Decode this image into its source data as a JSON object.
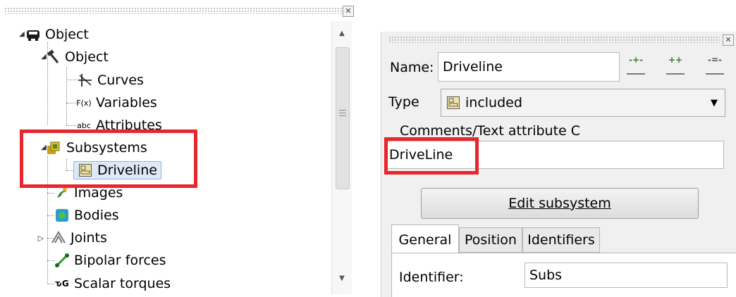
{
  "tree": {
    "root_label": "Object",
    "object_label": "Object",
    "curves_label": "Curves",
    "variables_label": "Variables",
    "attributes_label": "Attributes",
    "subsystems_label": "Subsystems",
    "driveline_label": "Driveline",
    "images_label": "Images",
    "bodies_label": "Bodies",
    "joints_label": "Joints",
    "bipolar_forces_label": "Bipolar forces",
    "scalar_torques_label": "Scalar torques"
  },
  "properties": {
    "name_label": "Name:",
    "name_value": "Driveline",
    "type_label": "Type",
    "type_value": "included",
    "comments_label": "Comments/Text attribute C",
    "comments_value": "DriveLine",
    "edit_button_label": "Edit subsystem",
    "tabs": [
      "General",
      "Position",
      "Identifiers"
    ],
    "identifier_label": "Identifier:",
    "identifier_value": "Subs"
  },
  "colors": {
    "highlight_box": "#e8262c",
    "selection_bg": "#dde9f7"
  }
}
